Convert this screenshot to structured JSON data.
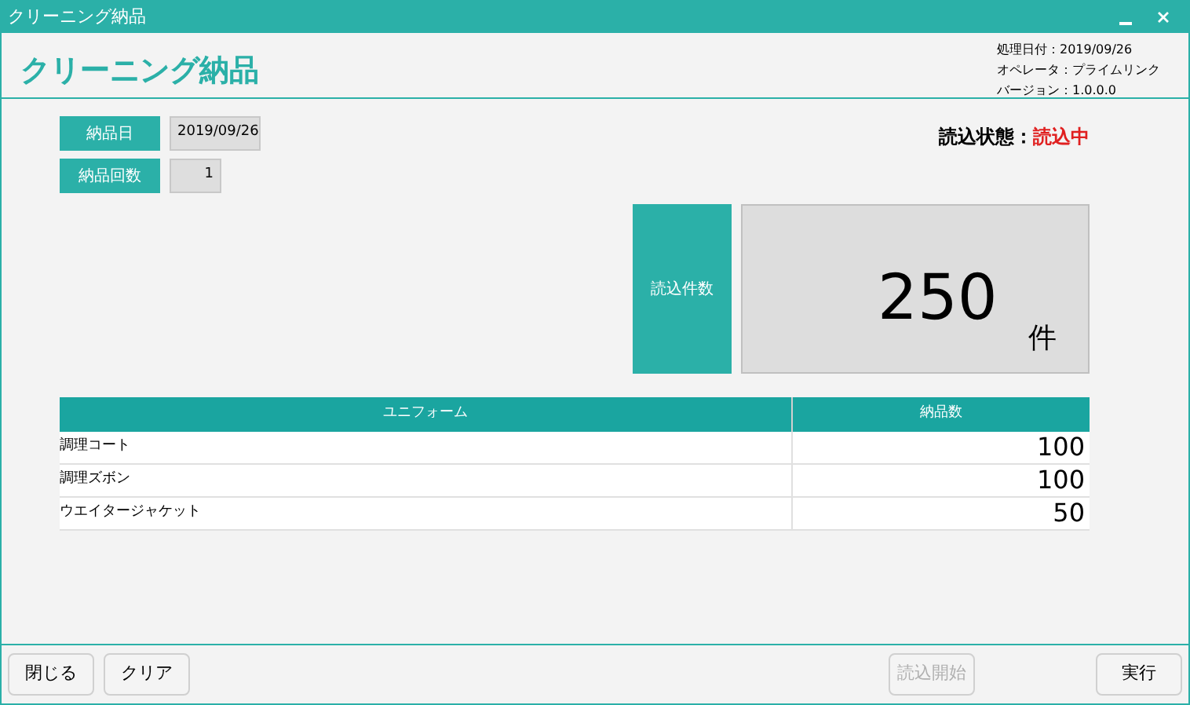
{
  "window": {
    "title": "クリーニング納品"
  },
  "header": {
    "title": "クリーニング納品",
    "info": [
      "処理日付：2019/09/26",
      "オペレータ：プライムリンク",
      "バージョン：1.0.0.0"
    ]
  },
  "fields": [
    {
      "label": "納品日",
      "value": "2019/09/26",
      "kind": "date"
    },
    {
      "label": "納品回数",
      "value": "1",
      "kind": "number"
    }
  ],
  "status": {
    "label": "読込状態：",
    "value": "読込中"
  },
  "count": {
    "label": "読込件数",
    "value": "250",
    "unit": "件"
  },
  "table": {
    "columns": [
      "ユニフォーム",
      "納品数"
    ],
    "rows": [
      [
        "調理コート",
        "100"
      ],
      [
        "調理ズボン",
        "100"
      ],
      [
        "ウエイタージャケット",
        "50"
      ]
    ]
  },
  "buttons_left": [
    {
      "label": "閉じる",
      "disabled": false
    },
    {
      "label": "クリア",
      "disabled": false
    }
  ],
  "buttons_right": [
    {
      "label": "読込開始",
      "disabled": true
    },
    {
      "label": "実行",
      "disabled": false
    }
  ]
}
